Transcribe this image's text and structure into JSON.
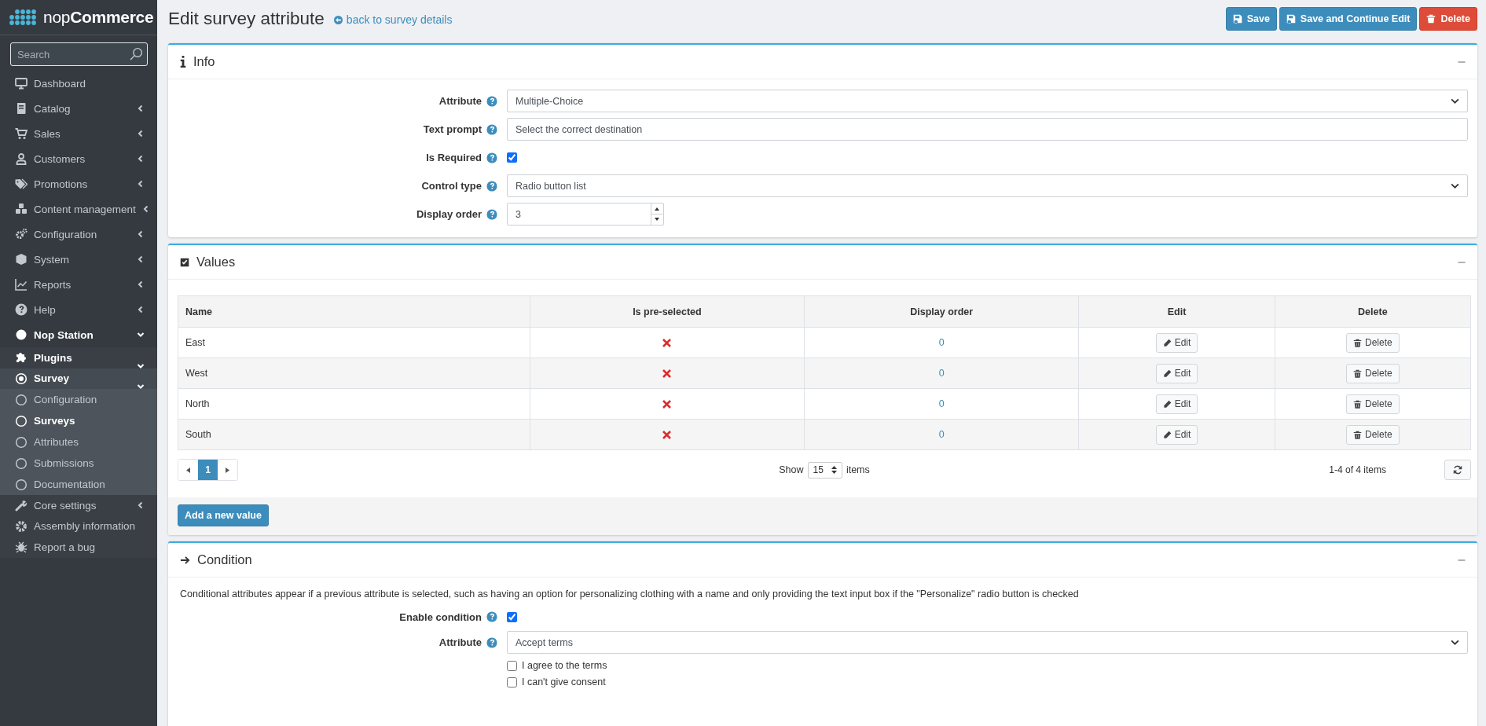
{
  "sidebar": {
    "logo": "nop**Commerce**",
    "search": {
      "placeholder": "Search"
    },
    "items": [
      {
        "label": "Dashboard",
        "selected": false
      },
      {
        "label": "Catalog",
        "selected": false,
        "expanded": false
      },
      {
        "label": "Sales",
        "selected": false,
        "expanded": false
      },
      {
        "label": "Customers",
        "selected": false,
        "expanded": false
      },
      {
        "label": "Promotions",
        "selected": false,
        "expanded": false
      },
      {
        "label": "Content management",
        "selected": false,
        "expanded": false
      },
      {
        "label": "Configuration",
        "selected": false,
        "expanded": false
      },
      {
        "label": "System",
        "selected": false,
        "expanded": false
      },
      {
        "label": "Reports",
        "selected": false,
        "expanded": false
      },
      {
        "label": "Help",
        "selected": false,
        "expanded": false
      },
      {
        "label": "Nop Station",
        "selected": true,
        "expanded": true,
        "children": [
          {
            "label": "Plugins",
            "selected": true,
            "expanded": true,
            "children": [
              {
                "label": "Survey",
                "selected": true,
                "expanded": true,
                "children": [
                  {
                    "label": "Configuration",
                    "selected": false
                  },
                  {
                    "label": "Surveys",
                    "selected": true
                  },
                  {
                    "label": "Attributes",
                    "selected": false
                  },
                  {
                    "label": "Submissions",
                    "selected": false
                  },
                  {
                    "label": "Documentation",
                    "selected": false
                  }
                ]
              }
            ]
          },
          {
            "label": "Core settings",
            "selected": false,
            "expanded": false
          },
          {
            "label": "Assembly information",
            "selected": false
          },
          {
            "label": "Report a bug",
            "selected": false
          }
        ]
      }
    ]
  },
  "header": {
    "title": "Edit survey attribute",
    "back_link": "back to survey details",
    "buttons": [
      {
        "label": "Save",
        "kind": "primary"
      },
      {
        "label": "Save and Continue Edit",
        "kind": "primary"
      },
      {
        "label": "Delete",
        "kind": "danger"
      }
    ]
  },
  "info": {
    "title": "Info",
    "fields": [
      {
        "label": "Attribute",
        "kind": "select",
        "value": "Multiple-Choice"
      },
      {
        "label": "Text prompt",
        "kind": "text",
        "value": "Select the correct destination"
      },
      {
        "label": "Is Required",
        "kind": "checkbox",
        "checked": true
      },
      {
        "label": "Control type",
        "kind": "select",
        "value": "Radio button list"
      },
      {
        "label": "Display order",
        "kind": "number",
        "value": "3"
      }
    ]
  },
  "values": {
    "title": "Values",
    "columns": [
      "Name",
      "Is pre-selected",
      "Display order",
      "Edit",
      "Delete"
    ],
    "rows": [
      {
        "name": "East",
        "pre_selected": false,
        "display_order": "0",
        "edit": "Edit",
        "delete": "Delete"
      },
      {
        "name": "West",
        "pre_selected": false,
        "display_order": "0",
        "edit": "Edit",
        "delete": "Delete"
      },
      {
        "name": "North",
        "pre_selected": false,
        "display_order": "0",
        "edit": "Edit",
        "delete": "Delete"
      },
      {
        "name": "South",
        "pre_selected": false,
        "display_order": "0",
        "edit": "Edit",
        "delete": "Delete"
      }
    ],
    "pager": {
      "pages": [
        {
          "label": "1",
          "selected": true
        }
      ],
      "show": "Show",
      "page_size": "15",
      "items_label": "items",
      "summary": "1-4 of 4 items"
    },
    "add_button": "Add a new value"
  },
  "condition": {
    "title": "Condition",
    "description": "Conditional attributes appear if a previous attribute is selected, such as having an option for personalizing clothing with a name and only providing the text input box if the \"Personalize\" radio button is checked",
    "fields": [
      {
        "label": "Enable condition",
        "kind": "checkbox",
        "checked": true
      },
      {
        "label": "Attribute",
        "kind": "select",
        "value": "Accept terms"
      }
    ],
    "options": [
      {
        "label": "I agree to the terms",
        "checked": false
      },
      {
        "label": "I can't give consent",
        "checked": false
      }
    ]
  }
}
